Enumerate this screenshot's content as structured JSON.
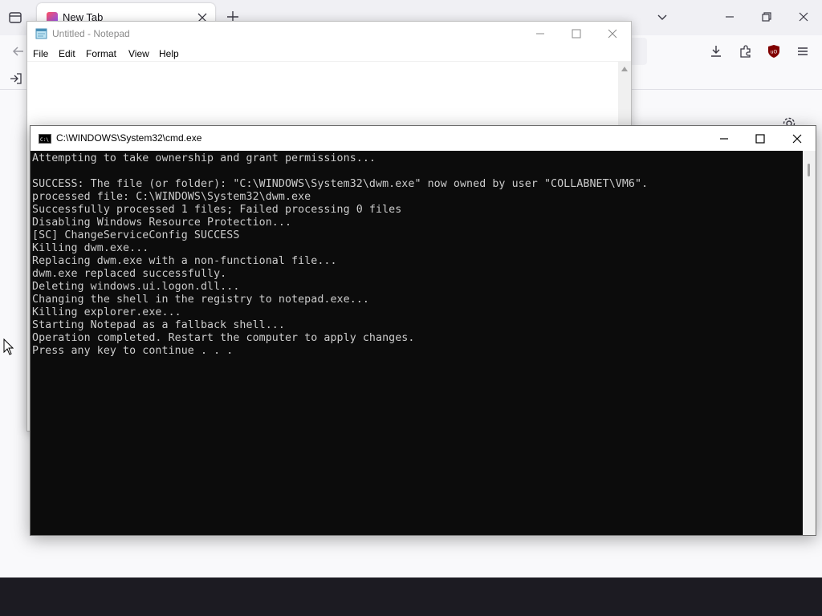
{
  "browser": {
    "tab": {
      "title": "New Tab"
    },
    "icons": {
      "list_all_tabs": "list-all-tabs-icon",
      "tab_close": "close-icon",
      "new_tab": "plus-icon",
      "tab_list": "chevron-down-icon",
      "minimize": "minimize-icon",
      "restore": "restore-icon",
      "close": "close-icon",
      "back": "back-arrow-icon",
      "downloads": "download-icon",
      "extensions": "puzzle-icon",
      "ublock": "ublock-origin-icon",
      "menu": "hamburger-menu-icon",
      "import": "import-icon",
      "settings": "gear-icon"
    }
  },
  "notepad": {
    "title": "Untitled - Notepad",
    "menu": [
      "File",
      "Edit",
      "Format",
      "View",
      "Help"
    ],
    "content": ""
  },
  "cmd": {
    "title": "C:\\WINDOWS\\System32\\cmd.exe",
    "lines": [
      "Attempting to take ownership and grant permissions...",
      "",
      "SUCCESS: The file (or folder): \"C:\\WINDOWS\\System32\\dwm.exe\" now owned by user \"COLLABNET\\VM6\".",
      "processed file: C:\\WINDOWS\\System32\\dwm.exe",
      "Successfully processed 1 files; Failed processing 0 files",
      "Disabling Windows Resource Protection...",
      "[SC] ChangeServiceConfig SUCCESS",
      "Killing dwm.exe...",
      "Replacing dwm.exe with a non-functional file...",
      "dwm.exe replaced successfully.",
      "Deleting windows.ui.logon.dll...",
      "Changing the shell in the registry to notepad.exe...",
      "Killing explorer.exe...",
      "Starting Notepad as a fallback shell...",
      "Operation completed. Restart the computer to apply changes.",
      "Press any key to continue . . ."
    ]
  },
  "colors": {
    "console_bg": "#0c0c0c",
    "console_text": "#cccccc",
    "taskbar": "#000000",
    "browser_chrome": "#f0f0f4"
  }
}
